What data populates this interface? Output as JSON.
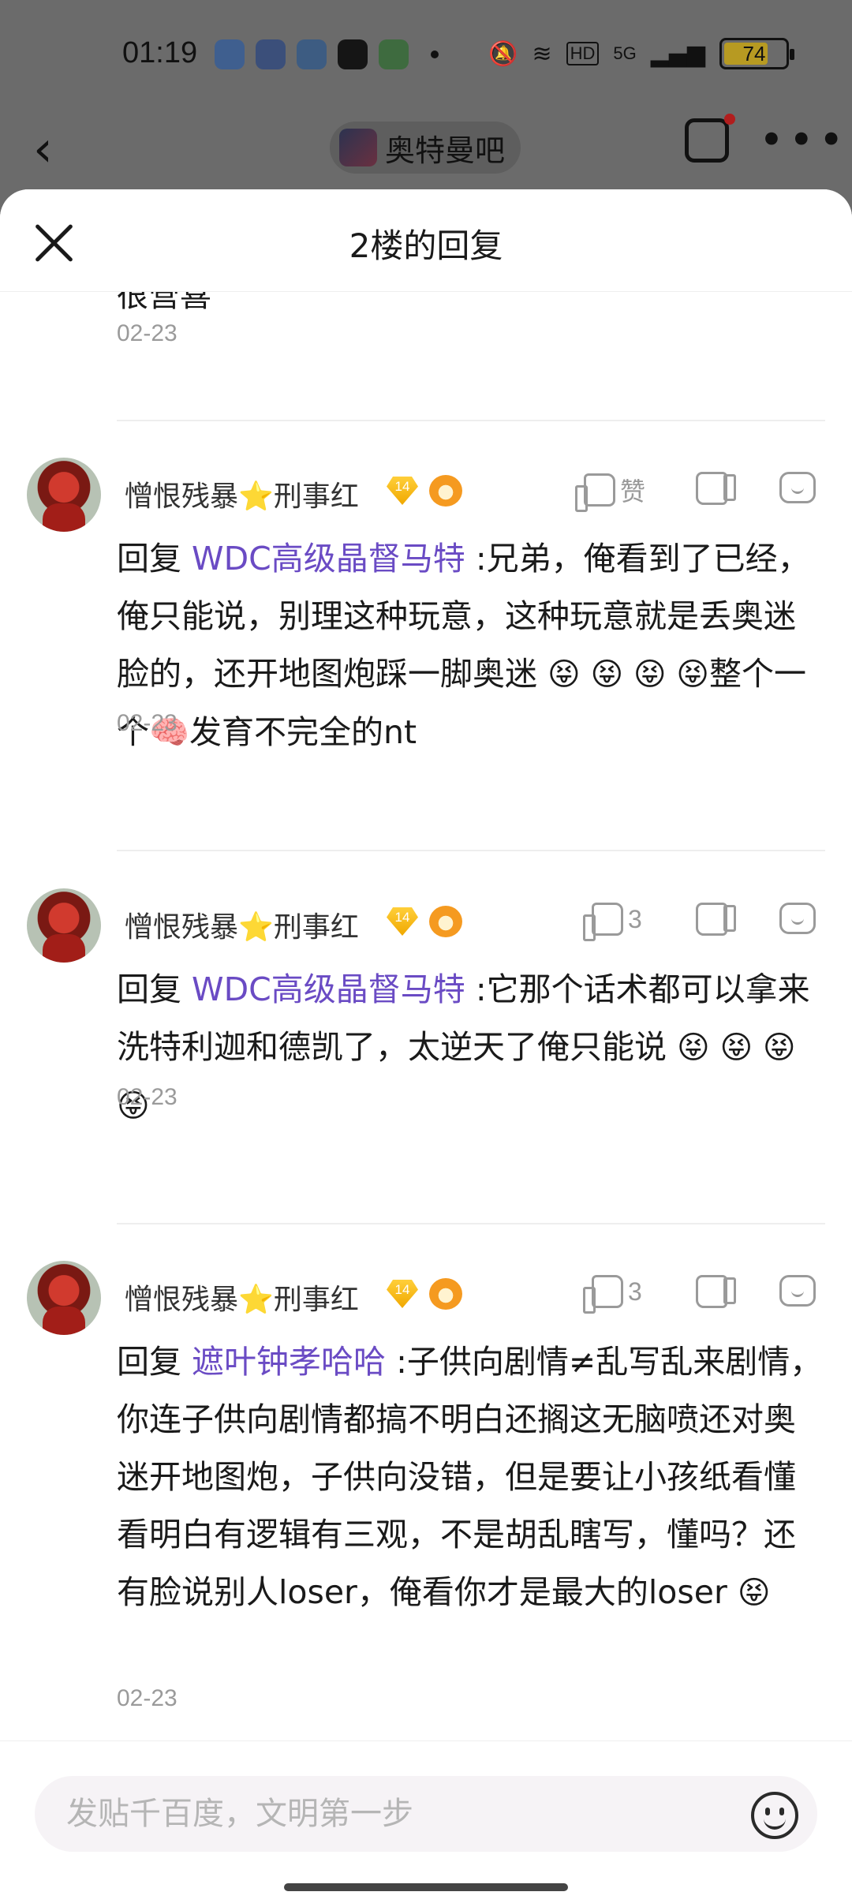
{
  "status_bar": {
    "time": "01:19",
    "battery": "74",
    "battery_level": 0.74,
    "network": "5G",
    "hd_label": "HD",
    "app_icons": [
      {
        "name": "app-blue-square-icon",
        "color": "#2f7cf6"
      },
      {
        "name": "baidu-app-icon",
        "color": "#3a6df0"
      },
      {
        "name": "browser-app-icon",
        "color": "#2b8ff7"
      },
      {
        "name": "tiktok-app-icon",
        "color": "#111111"
      },
      {
        "name": "green-shop-app-icon",
        "color": "#3ab54a"
      }
    ]
  },
  "background_header": {
    "back_icon": "‹",
    "forum_name": "奥特曼吧",
    "more_icon": "•••"
  },
  "sheet": {
    "title": "2楼的回复",
    "partial_text": "很营喜",
    "partial_date": "02-23"
  },
  "replies": [
    {
      "user": "憎恨残暴",
      "star": "⭐",
      "user_suffix": "刑事红",
      "level": "14",
      "likes": "赞",
      "reply_prefix": "回复",
      "mention": "WDC高级晶督马特",
      "text": ":兄弟，俺看到了已经，俺只能说，别理这种玩意，这种玩意就是丢奥迷脸的，还开地图炮踩一脚奥迷",
      "emojis": "😝 😝 😝 😝",
      "text_after": "整个一个🧠发育不完全的nt",
      "date": "02-23"
    },
    {
      "user": "憎恨残暴",
      "star": "⭐",
      "user_suffix": "刑事红",
      "level": "14",
      "likes": "3",
      "reply_prefix": "回复",
      "mention": "WDC高级晶督马特",
      "text": ":它那个话术都可以拿来洗特利迦和德凯了，太逆天了俺只能说",
      "emojis": "😝 😝 😝 😝",
      "text_after": "",
      "date": "02-23"
    },
    {
      "user": "憎恨残暴",
      "star": "⭐",
      "user_suffix": "刑事红",
      "level": "14",
      "likes": "3",
      "reply_prefix": "回复",
      "mention": "遮叶钟孝哈哈",
      "text": ":子供向剧情≠乱写乱来剧情，你连子供向剧情都搞不明白还搁这无脑喷还对奥迷开地图炮，子供向没错，但是要让小孩纸看懂看明白有逻辑有三观，不是胡乱瞎写，懂吗？还有脸说别人loser，俺看你才是最大的loser",
      "emojis": "😝",
      "text_after": "",
      "date": "02-23"
    }
  ],
  "composer": {
    "placeholder": "发贴千百度，文明第一步"
  }
}
